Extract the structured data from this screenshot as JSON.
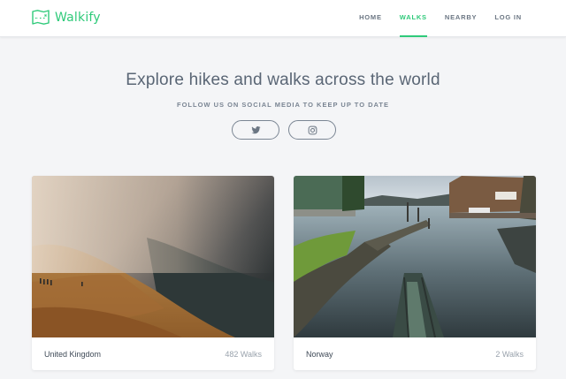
{
  "brand": {
    "name": "Walkify",
    "icon": "map-icon",
    "color": "#2fca7a"
  },
  "nav": [
    {
      "label": "HOME",
      "active": false
    },
    {
      "label": "WALKS",
      "active": true
    },
    {
      "label": "NEARBY",
      "active": false
    },
    {
      "label": "LOG IN",
      "active": false
    }
  ],
  "hero": {
    "title": "Explore hikes and walks across the world",
    "subtitle": "FOLLOW US ON SOCIAL MEDIA TO KEEP UP TO DATE",
    "social": [
      {
        "icon": "twitter-icon"
      },
      {
        "icon": "instagram-icon"
      }
    ]
  },
  "cards": [
    {
      "country": "United Kingdom",
      "walks": "482 Walks",
      "image": "misty-hillside-photo"
    },
    {
      "country": "Norway",
      "walks": "2 Walks",
      "image": "fjord-harbour-photo"
    }
  ]
}
